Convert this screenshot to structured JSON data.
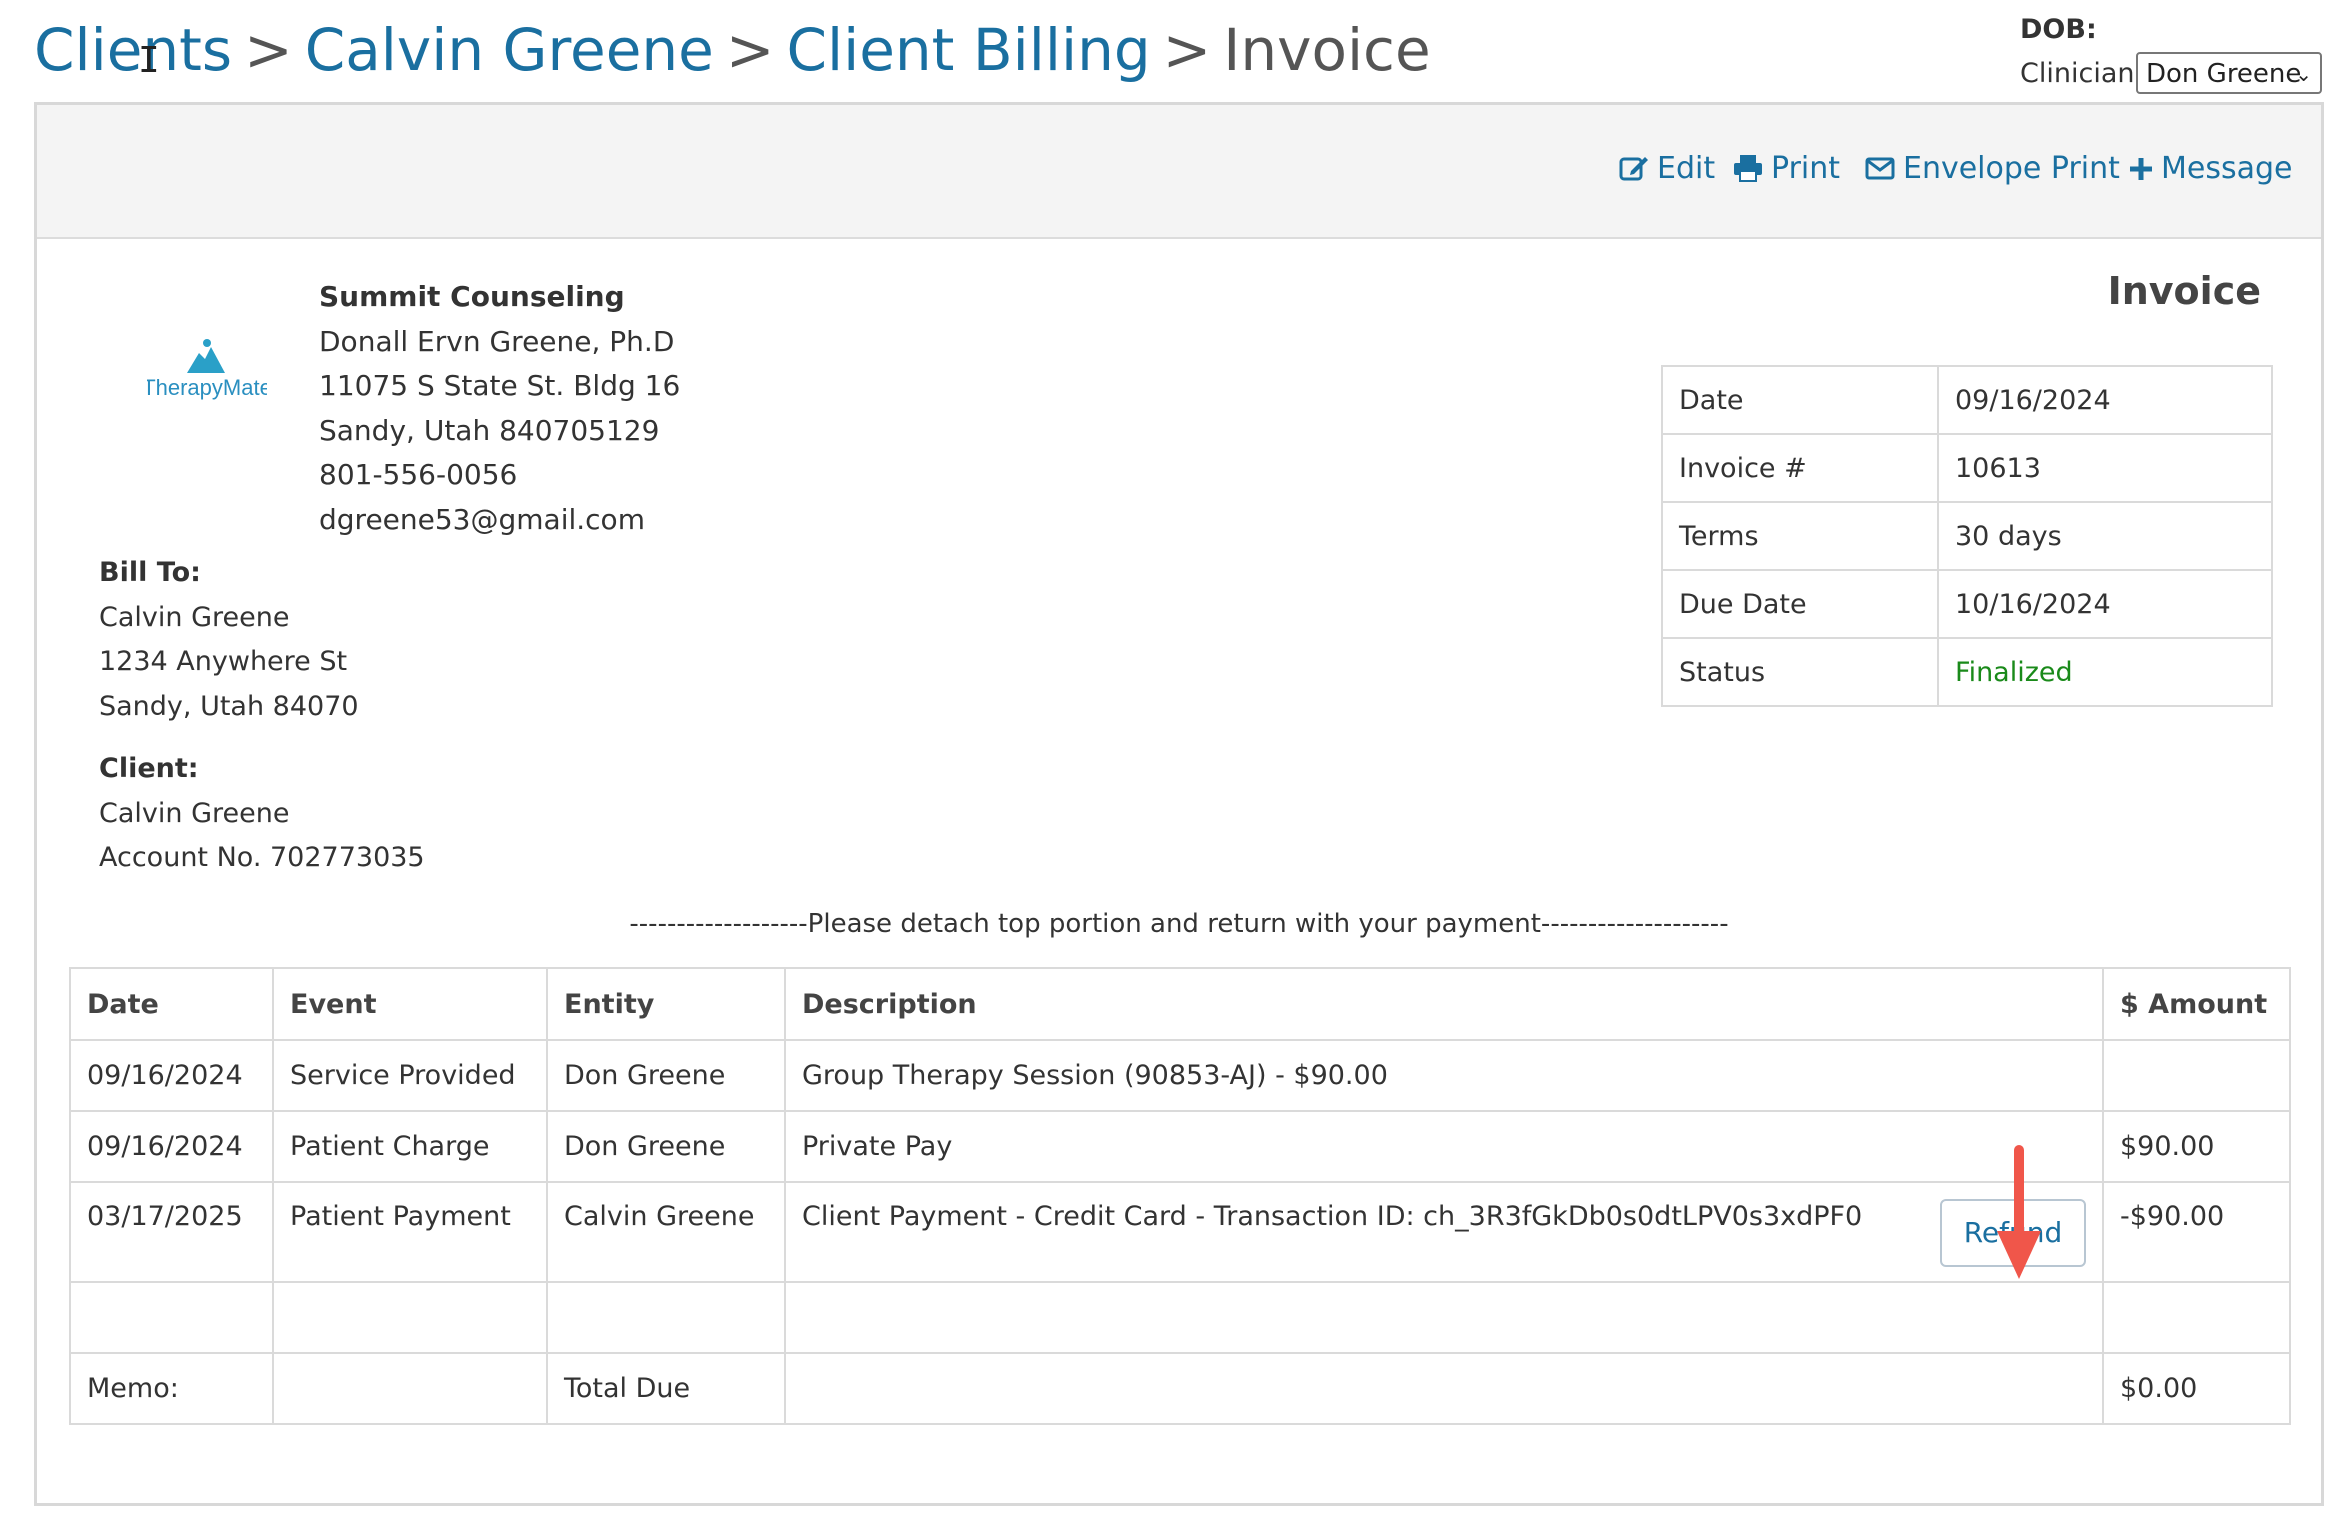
{
  "breadcrumb": {
    "clients": "Clients",
    "client_name": "Calvin Greene",
    "client_billing": "Client Billing",
    "current": "Invoice",
    "separator": ">"
  },
  "header": {
    "dob_label": "DOB:",
    "clinician_label": "Clinician:",
    "clinician_value": "Don Greene"
  },
  "toolbar": {
    "edit": "Edit",
    "print": "Print",
    "envelope_print": "Envelope Print",
    "message": "Message"
  },
  "logo": {
    "text": "TherapyMate"
  },
  "practice": {
    "name": "Summit Counseling",
    "provider": "Donall Ervn Greene, Ph.D",
    "street": "11075 S State St. Bldg 16",
    "city": "Sandy, Utah 840705129",
    "phone": "801-556-0056",
    "email": "dgreene53@gmail.com"
  },
  "invoice": {
    "title": "Invoice",
    "fields": [
      {
        "label": "Date",
        "value": "09/16/2024"
      },
      {
        "label": "Invoice #",
        "value": "10613"
      },
      {
        "label": "Terms",
        "value": "30 days"
      },
      {
        "label": "Due Date",
        "value": "10/16/2024"
      },
      {
        "label": "Status",
        "value": "Finalized"
      }
    ],
    "status_color": "#1a8a1a"
  },
  "bill_to": {
    "heading": "Bill To:",
    "name": "Calvin Greene",
    "street": "1234 Anywhere St",
    "city": "Sandy, Utah 84070"
  },
  "client": {
    "heading": "Client:",
    "name": "Calvin Greene",
    "account": "Account No. 702773035"
  },
  "detach_note": "-------------------Please detach top portion and return with your payment--------------------",
  "lines": {
    "headers": [
      "Date",
      "Event",
      "Entity",
      "Description",
      "$ Amount"
    ],
    "rows": [
      {
        "date": "09/16/2024",
        "event": "Service Provided",
        "entity": "Don Greene",
        "description": "Group Therapy Session (90853-AJ) - $90.00",
        "amount": ""
      },
      {
        "date": "09/16/2024",
        "event": "Patient Charge",
        "entity": "Don Greene",
        "description": "Private Pay",
        "amount": "$90.00"
      },
      {
        "date": "03/17/2025",
        "event": "Patient Payment",
        "entity": "Calvin Greene",
        "description": "Client Payment - Credit Card - Transaction ID: ch_3R3fGkDb0s0dtLPV0s3xdPF0",
        "amount": "-$90.00",
        "action": "Refund"
      }
    ],
    "memo_label": "Memo:",
    "total_label": "Total Due",
    "total_value": "$0.00"
  },
  "colors": {
    "link": "#1a6fa0",
    "annotation_arrow": "#f0564a"
  }
}
